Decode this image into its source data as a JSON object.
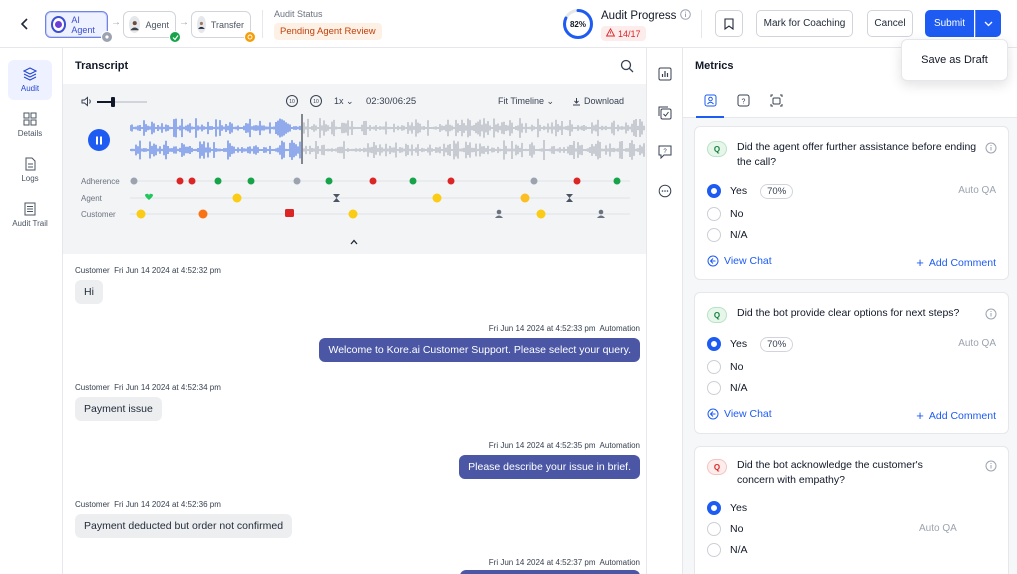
{
  "header": {
    "steps": [
      {
        "label": "AI Agent"
      },
      {
        "label": "Agent"
      },
      {
        "label": "Transfer"
      }
    ],
    "audit_status_title": "Audit Status",
    "audit_status_value": "Pending Agent Review",
    "audit_progress_title": "Audit Progress",
    "audit_progress_percent": "82%",
    "audit_progress_fraction": 0.82,
    "audit_warning": "14/17",
    "mark_coaching": "Mark for Coaching",
    "cancel": "Cancel",
    "submit": "Submit",
    "save_draft": "Save as Draft"
  },
  "nav": {
    "items": [
      {
        "label": "Audit"
      },
      {
        "label": "Details"
      },
      {
        "label": "Logs"
      },
      {
        "label": "Audit Trail"
      }
    ]
  },
  "transcript": {
    "title": "Transcript",
    "player": {
      "speed": "1x",
      "time": "02:30/06:25",
      "fit_timeline": "Fit Timeline",
      "download": "Download",
      "rows": [
        "Adherence",
        "Agent",
        "Customer"
      ]
    },
    "messages": [
      {
        "speaker": "Customer",
        "time": "Fri Jun 14 2024 at 4:52:32 pm",
        "text": "Hi"
      },
      {
        "speaker": "Automation",
        "time": "Fri Jun 14 2024 at 4:52:33 pm",
        "text": "Welcome to Kore.ai Customer Support. Please select your query."
      },
      {
        "speaker": "Customer",
        "time": "Fri Jun 14 2024 at 4:52:34 pm",
        "text": "Payment issue"
      },
      {
        "speaker": "Automation",
        "time": "Fri Jun 14 2024 at 4:52:35 pm",
        "text": "Please describe your issue in brief."
      },
      {
        "speaker": "Customer",
        "time": "Fri Jun 14 2024 at 4:52:36 pm",
        "text": "Payment deducted but order not confirmed"
      },
      {
        "speaker": "Automation",
        "time": "Fri Jun 14 2024 at 4:52:37 pm",
        "text": ""
      }
    ]
  },
  "metrics": {
    "title": "Metrics",
    "badge": "Q",
    "questions": [
      {
        "text": "Did the agent offer further assistance before ending the call?",
        "options": [
          "Yes",
          "No",
          "N/A"
        ],
        "selected_pct": "70%",
        "auto_qa": "Auto QA",
        "view_chat": "View Chat",
        "add_comment": "Add Comment"
      },
      {
        "text": "Did the bot provide clear options for next steps?",
        "options": [
          "Yes",
          "No",
          "N/A"
        ],
        "selected_pct": "70%",
        "auto_qa": "Auto QA",
        "view_chat": "View Chat",
        "add_comment": "Add Comment"
      },
      {
        "text": "Did the bot acknowledge the customer's concern with empathy?",
        "options": [
          "Yes",
          "No",
          "N/A"
        ],
        "auto_qa": "Auto QA"
      }
    ]
  },
  "colors": {
    "primary": "#1d5bf2",
    "automation_bubble": "#4b57a5",
    "status": "#c2410c",
    "adherence_ok": "#16a34a",
    "adherence_fail": "#dc2626"
  }
}
